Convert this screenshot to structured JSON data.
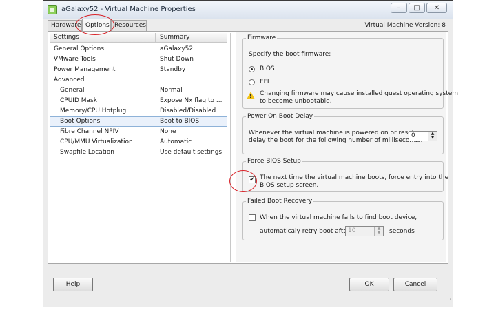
{
  "window": {
    "title": "aGalaxy52 - Virtual Machine Properties",
    "controls": {
      "minimize": "–",
      "maximize": "□",
      "close": "✕"
    }
  },
  "tabs": [
    {
      "label": "Hardware"
    },
    {
      "label": "Options"
    },
    {
      "label": "Resources"
    }
  ],
  "vm_version": "Virtual Machine Version: 8",
  "settings_list": {
    "headers": {
      "settings": "Settings",
      "summary": "Summary"
    },
    "rows": [
      {
        "setting": "General Options",
        "summary": "aGalaxy52"
      },
      {
        "setting": "VMware Tools",
        "summary": "Shut Down"
      },
      {
        "setting": "Power Management",
        "summary": "Standby"
      },
      {
        "setting": "Advanced",
        "summary": ""
      },
      {
        "setting": "General",
        "summary": "Normal"
      },
      {
        "setting": "CPUID Mask",
        "summary": "Expose Nx flag to ..."
      },
      {
        "setting": "Memory/CPU Hotplug",
        "summary": "Disabled/Disabled"
      },
      {
        "setting": "Boot Options",
        "summary": "Boot to BIOS"
      },
      {
        "setting": "Fibre Channel NPIV",
        "summary": "None"
      },
      {
        "setting": "CPU/MMU Virtualization",
        "summary": "Automatic"
      },
      {
        "setting": "Swapfile Location",
        "summary": "Use default settings"
      }
    ]
  },
  "firmware": {
    "legend": "Firmware",
    "instruction": "Specify the boot firmware:",
    "option_bios": "BIOS",
    "option_efi": "EFI",
    "warning_line1": "Changing firmware may cause installed guest operating system",
    "warning_line2": "to become unbootable."
  },
  "power_on_delay": {
    "legend": "Power On Boot Delay",
    "text_line1": "Whenever the virtual machine is powered on or reset,",
    "text_line2": "delay the boot for the following number of milliseconds:",
    "value": "0"
  },
  "force_bios": {
    "legend": "Force BIOS Setup",
    "text_line1": "The next time the virtual machine boots, force entry into the",
    "text_line2": "BIOS setup screen.",
    "checked_mark": "✔"
  },
  "failed_boot": {
    "legend": "Failed Boot Recovery",
    "text": "When the virtual machine fails to find boot device,",
    "retry_label": "automaticaly retry boot after",
    "retry_value": "10",
    "retry_unit": "seconds"
  },
  "buttons": {
    "help": "Help",
    "ok": "OK",
    "cancel": "Cancel"
  }
}
